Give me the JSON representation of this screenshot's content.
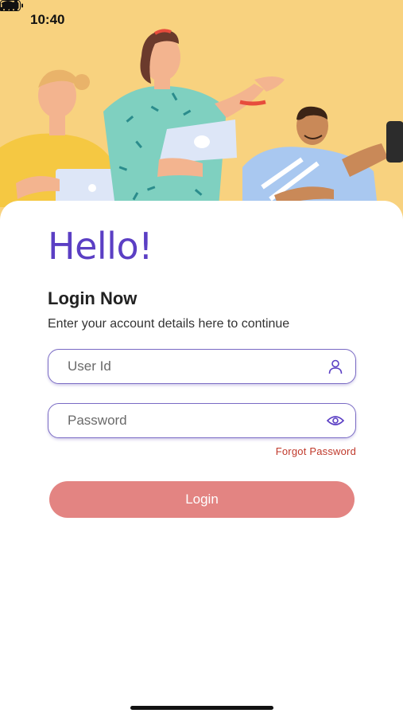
{
  "status_bar": {
    "time": "10:40",
    "icons": [
      "signal-icon",
      "wifi-icon",
      "battery-icon"
    ]
  },
  "hero": {
    "illustration": "people-with-laptops-illustration",
    "background_color": "#f8d27f"
  },
  "login_card": {
    "greeting": "Hello!",
    "heading": "Login Now",
    "subtitle": "Enter your account details here to continue",
    "user_id_placeholder": "User Id",
    "password_placeholder": "Password",
    "forgot_password": "Forgot Password",
    "login_button": "Login"
  },
  "colors": {
    "greeting": "#5b3fc4",
    "field_border": "#7a6bc4",
    "forgot_link": "#c0392b",
    "login_button": "#e38482"
  }
}
